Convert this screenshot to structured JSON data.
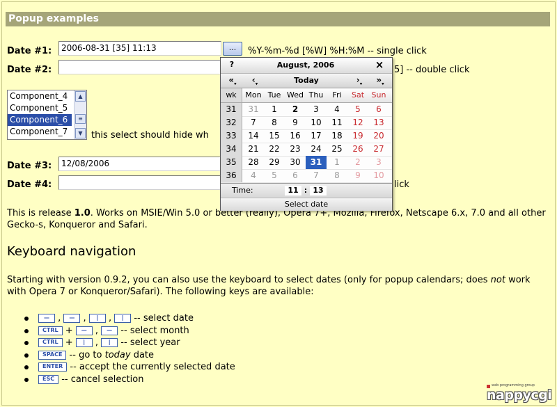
{
  "page": {
    "section_title": "Popup examples",
    "date1": {
      "label": "Date #1:",
      "value": "2006-08-31 [35] 11:13",
      "trigger_label": "...",
      "hint": "%Y-%m-%d [%W] %H:%M -- single click"
    },
    "date2": {
      "label": "Date #2:",
      "value": "",
      "hint_visible": "5] -- double click"
    },
    "listbox": {
      "options": [
        "Component_4",
        "Component_5",
        "Component_6",
        "Component_7"
      ],
      "selected": "Component_6",
      "note": "this select should hide wh"
    },
    "date3": {
      "label": "Date #3:",
      "value": "12/08/2006"
    },
    "date4": {
      "label": "Date #4:",
      "value": "",
      "hint_visible": "lick"
    },
    "release": {
      "pre": "This is release ",
      "version": "1.0",
      "post": ". Works on MSIE/Win 5.0 or better (really), Opera 7+, Mozilla, Firefox, Netscape 6.x, 7.0 and all other Gecko-s, Konqueror and Safari."
    },
    "kb_heading": "Keyboard navigation",
    "kb_intro_a": "Starting with version 0.9.2, you can also use the keyboard to select dates (only for popup calendars; does",
    "kb_intro_not": "not",
    "kb_intro_b": " work with Opera 7 or Konqueror/Safari). The following keys are available:",
    "keys": {
      "k1_text": " -- select date",
      "k2_key": "CTRL",
      "k2_text": " -- select month",
      "k3_key": "CTRL",
      "k3_text": " -- select year",
      "k4_key": "SPACE",
      "k4_text_a": " -- go to ",
      "k4_today": "today",
      "k4_text_b": " date",
      "k5_key": "ENTER",
      "k5_text": " -- accept the currently selected date",
      "k6_key": "ESC",
      "k6_text": " -- cancel selection",
      "arrow": "—",
      "bar": "|",
      "plus": " + ",
      "comma": " , "
    },
    "logo": {
      "small": "web programming group",
      "big": "nappycgi"
    }
  },
  "calendar": {
    "help": "?",
    "title": "August, 2006",
    "close": "×",
    "nav": {
      "prev_year": "«",
      "prev_month": "‹",
      "today": "Today",
      "next_month": "›",
      "next_year": "»"
    },
    "weekday_header": [
      "wk",
      "Mon",
      "Tue",
      "Wed",
      "Thu",
      "Fri",
      "Sat",
      "Sun"
    ],
    "weeks": [
      {
        "wk": "31",
        "days": [
          "31",
          "1",
          "2",
          "3",
          "4",
          "5",
          "6"
        ]
      },
      {
        "wk": "32",
        "days": [
          "7",
          "8",
          "9",
          "10",
          "11",
          "12",
          "13"
        ]
      },
      {
        "wk": "33",
        "days": [
          "14",
          "15",
          "16",
          "17",
          "18",
          "19",
          "20"
        ]
      },
      {
        "wk": "34",
        "days": [
          "21",
          "22",
          "23",
          "24",
          "25",
          "26",
          "27"
        ]
      },
      {
        "wk": "35",
        "days": [
          "28",
          "29",
          "30",
          "31",
          "1",
          "2",
          "3"
        ]
      },
      {
        "wk": "36",
        "days": [
          "4",
          "5",
          "6",
          "7",
          "8",
          "9",
          "10"
        ]
      }
    ],
    "selected_day": "31",
    "time_label": "Time:",
    "hour": "11",
    "minute": "13",
    "time_sep": ":",
    "footer": "Select date"
  },
  "colors": {
    "background": "#ffffc4",
    "title_bar": "#a5a579",
    "selection": "#2b5fbd",
    "weekend": "#c8282d"
  }
}
